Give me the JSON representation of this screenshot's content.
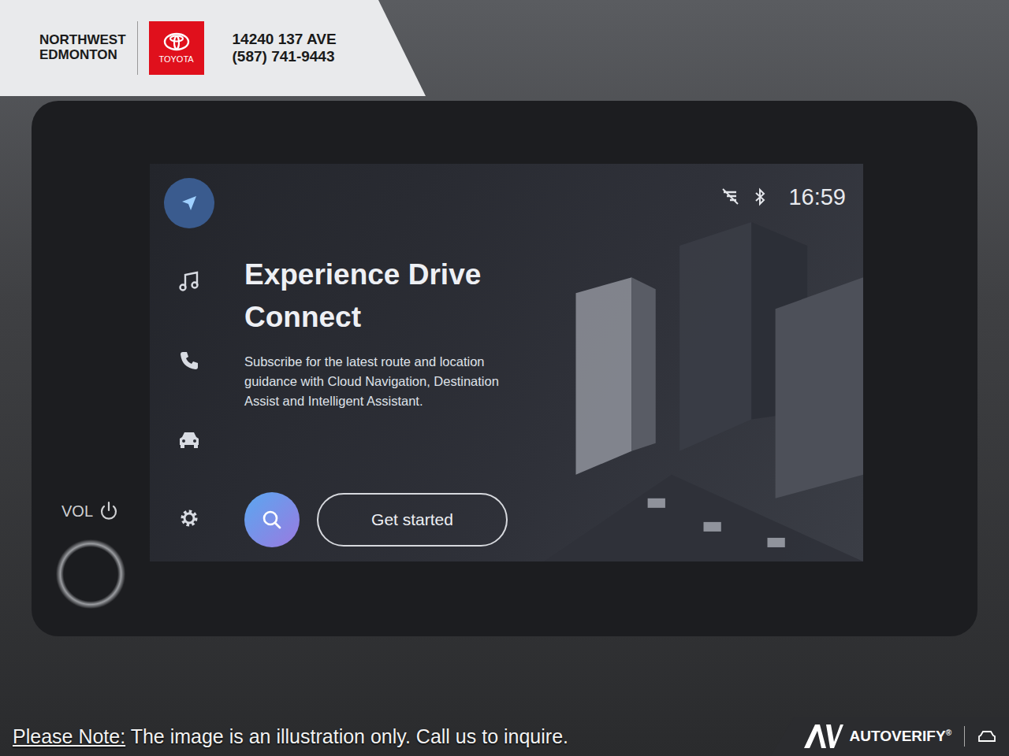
{
  "dealer": {
    "name_line1": "NORTHWEST",
    "name_line2": "EDMONTON",
    "brand": "TOYOTA",
    "address": "14240 137 AVE",
    "phone": "(587) 741-9443"
  },
  "controls": {
    "volume_label": "VOL"
  },
  "sidebar": {
    "items": [
      {
        "kind": "navigation",
        "selected": true
      },
      {
        "kind": "media",
        "selected": false
      },
      {
        "kind": "phone",
        "selected": false
      },
      {
        "kind": "vehicle",
        "selected": false
      },
      {
        "kind": "settings",
        "selected": false
      }
    ]
  },
  "status_bar": {
    "time": "16:59"
  },
  "promo": {
    "title": "Experience Drive Connect",
    "body": "Subscribe for the latest route and location guidance with Cloud Navigation, Destination Assist and Intelligent Assistant.",
    "button": "Get started"
  },
  "footer": {
    "note_label": "Please Note:",
    "note_text": " The image is an illustration only. Call us to inquire.",
    "brand": "AUTOVERIFY",
    "mark": "®"
  }
}
